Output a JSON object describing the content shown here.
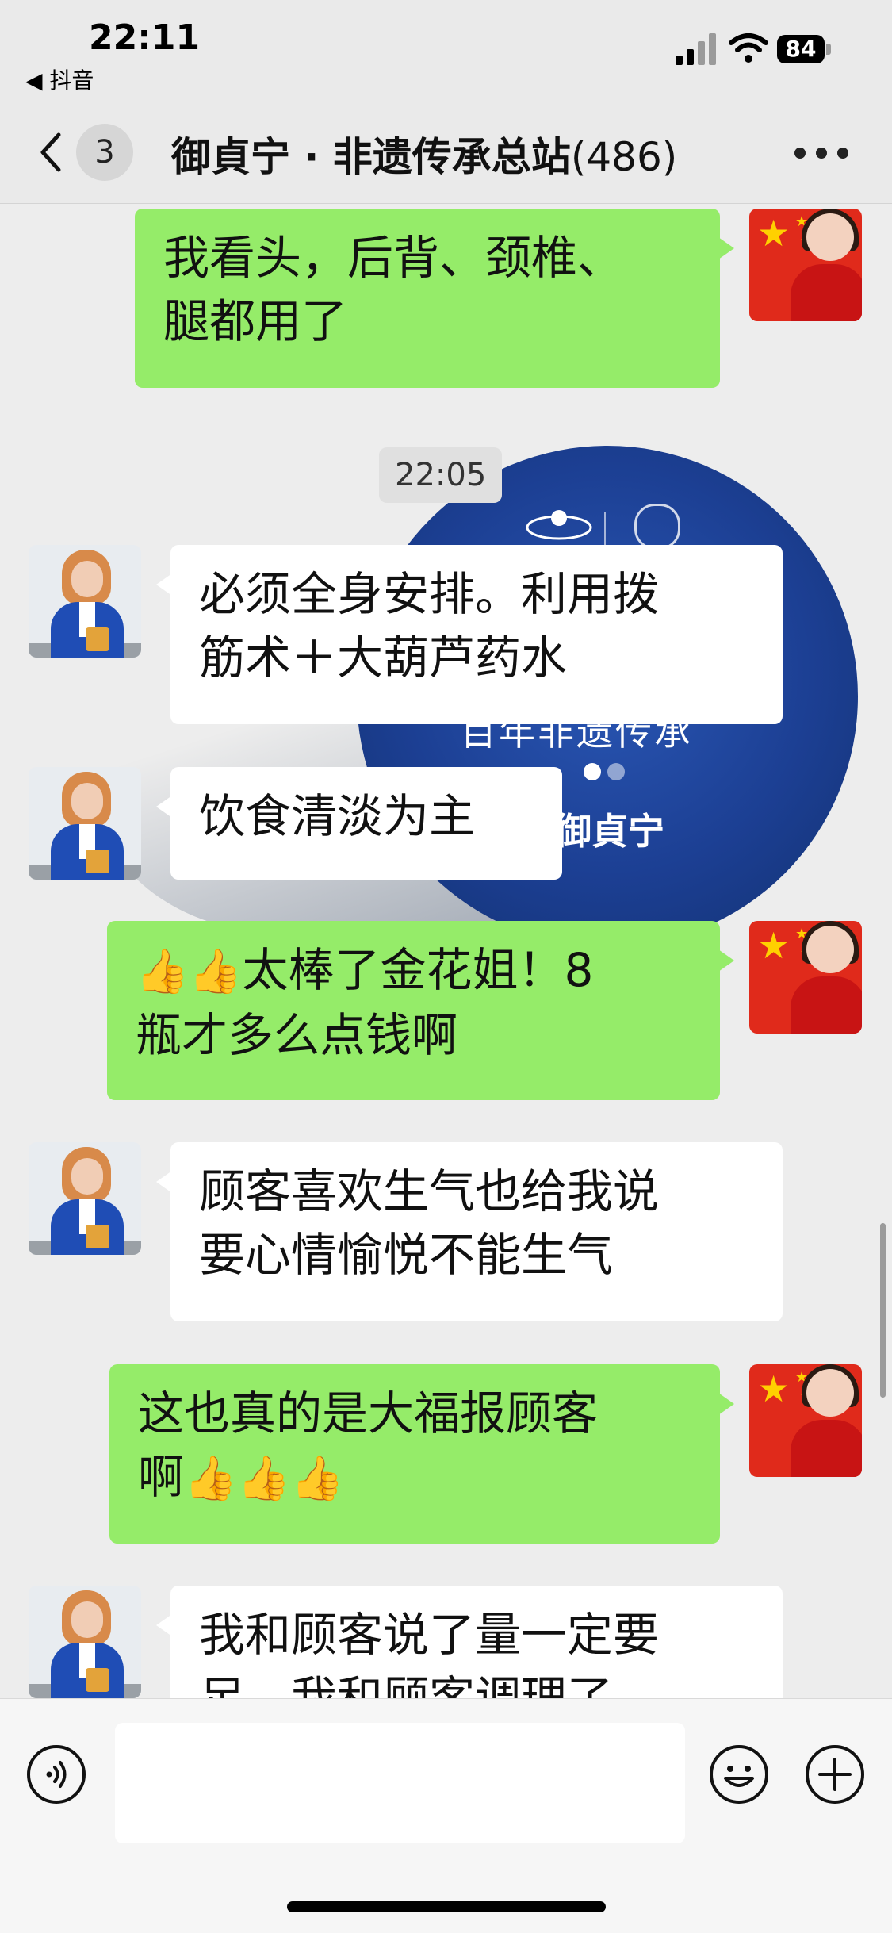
{
  "status_bar": {
    "time": "22:11",
    "back_app": "◀ 抖音",
    "battery": "84"
  },
  "nav": {
    "unread_count": "3",
    "title": "御貞宁 · 非遗传承总站",
    "member_count": "(486)"
  },
  "wallpaper": {
    "caption": "百年非遗传承",
    "brand": "御貞宁"
  },
  "chat": {
    "timestamp": "22:05",
    "messages": [
      {
        "side": "right",
        "line1": "我看头，后背、颈椎、",
        "line2": "腿都用了"
      },
      {
        "side": "left",
        "line1": "必须全身安排。利用拨",
        "line2": "筋术＋大葫芦药水"
      },
      {
        "side": "left",
        "line1": "饮食清淡为主"
      },
      {
        "side": "right",
        "line1_text": "太棒了金花姐！8",
        "line2": "瓶才多么点钱啊"
      },
      {
        "side": "left",
        "line1": "顾客喜欢生气也给我说",
        "line2": "要心情愉悦不能生气"
      },
      {
        "side": "right",
        "line1": "这也真的是大福报顾客",
        "line2_text": "啊"
      },
      {
        "side": "left",
        "line1": "我和顾客说了量一定要",
        "line2": "足，我和顾客调理了"
      }
    ]
  },
  "colors": {
    "outgoing_bubble": "#95ec69",
    "incoming_bubble": "#ffffff",
    "background": "#ededed"
  },
  "icons": {
    "thumbs_up": "👍",
    "voice": "voice-icon",
    "emoji": "emoji-icon",
    "plus": "plus-icon"
  }
}
